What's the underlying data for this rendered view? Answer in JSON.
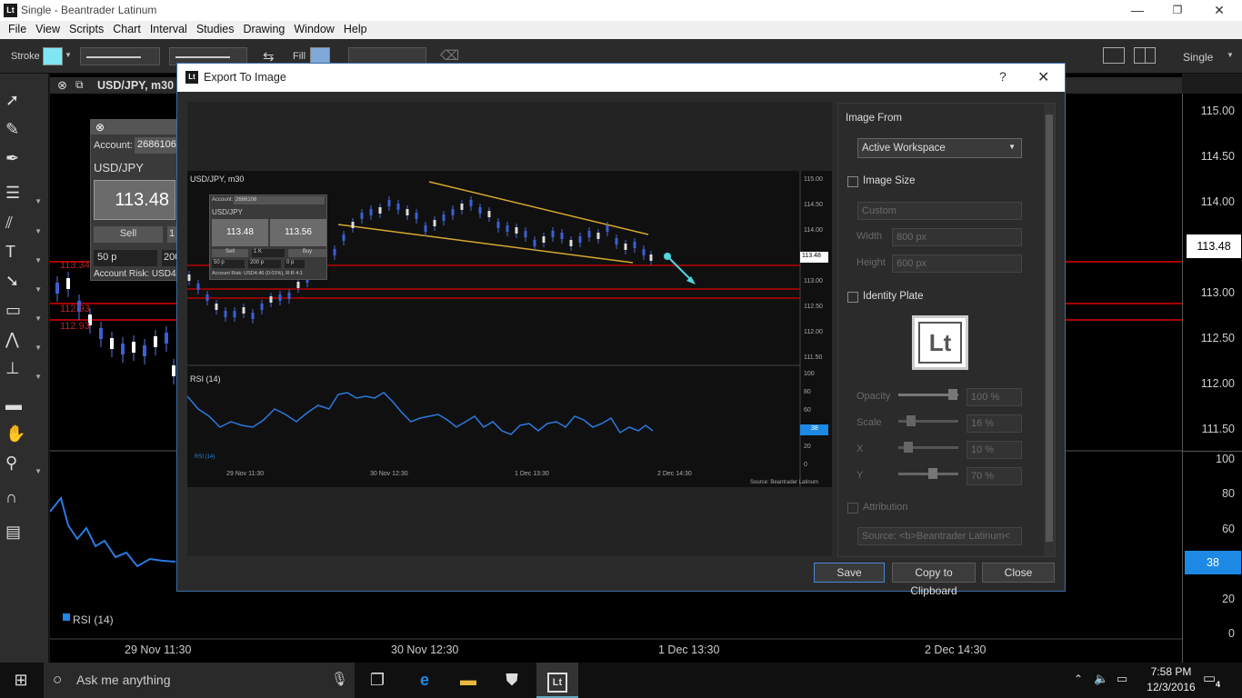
{
  "window": {
    "app_icon": "Lt",
    "title": "Single - Beantrader Latinum",
    "minimize": "—",
    "restore": "❐",
    "close": "✕"
  },
  "menu": [
    "File",
    "View",
    "Scripts",
    "Chart",
    "Interval",
    "Studies",
    "Drawing",
    "Window",
    "Help"
  ],
  "toolbar": {
    "stroke_label": "Stroke",
    "stroke_color": "#7fe6f2",
    "fill_label": "Fill",
    "fill_color": "#7fa9d8",
    "workspace_label": "Single"
  },
  "chart": {
    "symbol": "USD/JPY, m30",
    "price_ticks": [
      "115.00",
      "114.50",
      "114.00",
      "113.48",
      "113.00",
      "112.50",
      "112.00",
      "111.50"
    ],
    "current_price": "113.48",
    "rsi_ticks": [
      "100",
      "80",
      "60",
      "38",
      "20",
      "0"
    ],
    "rsi_current": "38",
    "rsi_label": "RSI (14)",
    "time_ticks": [
      "29 Nov 11:30",
      "30 Nov 12:30",
      "1 Dec 13:30",
      "2 Dec 14:30"
    ],
    "red_labels": [
      "113.34",
      "112.93",
      "112.93"
    ],
    "trade_panel": {
      "account_label": "Account:",
      "account": "2686106",
      "symbol": "USD/JPY",
      "bid": "113.48",
      "sell": "Sell",
      "qty": "1",
      "pips": "50 p",
      "second": "200",
      "risk": "Account Risk: USD4,4"
    }
  },
  "dialog": {
    "icon": "Lt",
    "title": "Export To Image",
    "help": "?",
    "close": "✕",
    "preview": {
      "symbol": "USD/JPY, m30",
      "price_ticks": [
        "115.00",
        "114.50",
        "114.00",
        "113.48",
        "113.00",
        "112.50",
        "112.00",
        "111.50"
      ],
      "current_price": "113.48",
      "rsi_ticks": [
        "100",
        "80",
        "60",
        "38",
        "20",
        "0"
      ],
      "rsi_label": "RSI (14)",
      "time_ticks": [
        "29 Nov 11:30",
        "30 Nov 12:30",
        "1 Dec 13:30",
        "2 Dec 14:30"
      ],
      "source": "Source: Beantrader Latinum",
      "trade": {
        "account": "Account:",
        "account_no": "2686106",
        "symbol": "USD/JPY",
        "bid": "113.48",
        "ask": "113.56",
        "sell": "Sell",
        "buy": "Buy",
        "qty": "1 K",
        "pips": "50 p",
        "p2": "200 p",
        "p3": "0 p",
        "risk": "Account Risk: USD4.46 (0.01%), R:R 4:1"
      }
    },
    "image_from_label": "Image From",
    "image_from_value": "Active Workspace",
    "image_size_label": "Image Size",
    "size_preset": "Custom",
    "width_label": "Width",
    "width_value": "800 px",
    "height_label": "Height",
    "height_value": "600 px",
    "identity_label": "Identity Plate",
    "identity_logo": "Lt",
    "opacity_label": "Opacity",
    "opacity_value": "100 %",
    "scale_label": "Scale",
    "scale_value": "16 %",
    "x_label": "X",
    "x_value": "10 %",
    "y_label": "Y",
    "y_value": "70 %",
    "attribution_label": "Attribution",
    "attribution_value": "Source: <b>Beantrader Latinum<",
    "save": "Save",
    "copy": "Copy to Clipboard",
    "close_btn": "Close"
  },
  "taskbar": {
    "search": "Ask me anything",
    "time": "7:58 PM",
    "date": "12/3/2016",
    "notifications": "4"
  }
}
